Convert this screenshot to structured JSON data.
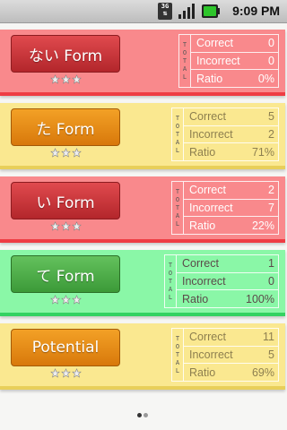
{
  "status_bar": {
    "network_label": "3G",
    "time": "9:09 PM"
  },
  "total_label": [
    "T",
    "O",
    "T",
    "A",
    "L"
  ],
  "labels": {
    "correct": "Correct",
    "incorrect": "Incorrect",
    "ratio": "Ratio"
  },
  "cards": [
    {
      "button": "ない Form",
      "correct": "0",
      "incorrect": "0",
      "ratio": "0%",
      "color": "red",
      "stars": 3
    },
    {
      "button": "た Form",
      "correct": "5",
      "incorrect": "2",
      "ratio": "71%",
      "color": "yellow",
      "stars": 3
    },
    {
      "button": "い Form",
      "correct": "2",
      "incorrect": "7",
      "ratio": "22%",
      "color": "red",
      "stars": 3
    },
    {
      "button": "て Form",
      "correct": "1",
      "incorrect": "0",
      "ratio": "100%",
      "color": "green",
      "stars": 3
    },
    {
      "button": "Potential",
      "correct": "11",
      "incorrect": "5",
      "ratio": "69%",
      "color": "yellow",
      "stars": 3
    }
  ],
  "pager": {
    "pages": 2,
    "current": 1
  }
}
